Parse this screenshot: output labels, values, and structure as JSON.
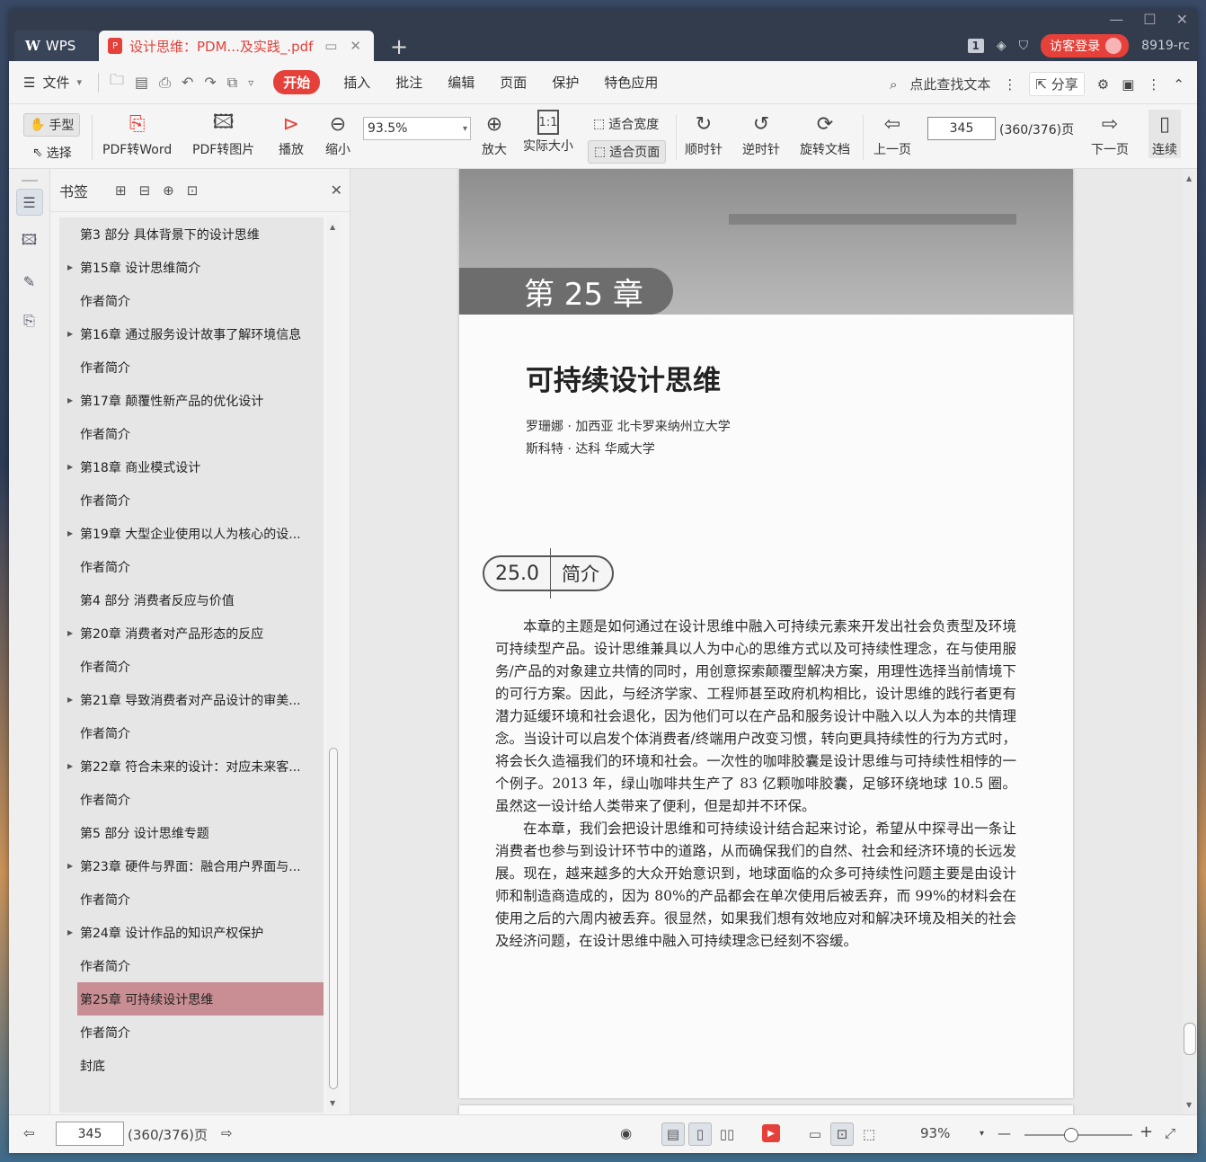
{
  "titlebar": {
    "app_tab": "WPS",
    "doc_tab": "设计思维：PDM...及实践_.pdf",
    "badge": "1",
    "guest_login": "访客登录",
    "version": "8919-rc"
  },
  "menu": {
    "file": "文件",
    "tabs": [
      "开始",
      "插入",
      "批注",
      "编辑",
      "页面",
      "保护",
      "特色应用"
    ],
    "active": "开始",
    "search": "点此查找文本",
    "share": "分享"
  },
  "toolbar": {
    "hand": "手型",
    "select": "选择",
    "pdf_to_word": "PDF转Word",
    "pdf_to_image": "PDF转图片",
    "play": "播放",
    "zoom_out": "缩小",
    "zoom_value": "93.5%",
    "zoom_in": "放大",
    "actual_size": "实际大小",
    "fit_width": "适合宽度",
    "fit_page": "适合页面",
    "clockwise": "顺时针",
    "counterclockwise": "逆时针",
    "rotate_doc": "旋转文档",
    "prev_page": "上一页",
    "page_value": "345",
    "page_total": "(360/376)页",
    "next_page": "下一页",
    "continuous": "连续"
  },
  "bookmarks": {
    "title": "书签",
    "items": [
      {
        "label": "第3 部分 具体背景下的设计思维",
        "expand": false
      },
      {
        "label": "第15章 设计思维简介",
        "expand": true
      },
      {
        "label": "作者简介",
        "expand": false
      },
      {
        "label": "第16章 通过服务设计故事了解环境信息",
        "expand": true
      },
      {
        "label": "作者简介",
        "expand": false
      },
      {
        "label": "第17章 颠覆性新产品的优化设计",
        "expand": true
      },
      {
        "label": "作者简介",
        "expand": false
      },
      {
        "label": "第18章 商业模式设计",
        "expand": true
      },
      {
        "label": "作者简介",
        "expand": false
      },
      {
        "label": "第19章 大型企业使用以人为核心的设...",
        "expand": true
      },
      {
        "label": "作者简介",
        "expand": false
      },
      {
        "label": "第4 部分 消费者反应与价值",
        "expand": false
      },
      {
        "label": "第20章 消费者对产品形态的反应",
        "expand": true
      },
      {
        "label": "作者简介",
        "expand": false
      },
      {
        "label": "第21章 导致消费者对产品设计的审美...",
        "expand": true
      },
      {
        "label": "作者简介",
        "expand": false
      },
      {
        "label": "第22章 符合未来的设计：对应未来客...",
        "expand": true
      },
      {
        "label": "作者简介",
        "expand": false
      },
      {
        "label": "第5 部分 设计思维专题",
        "expand": false
      },
      {
        "label": "第23章 硬件与界面：融合用户界面与...",
        "expand": true
      },
      {
        "label": "作者简介",
        "expand": false
      },
      {
        "label": "第24章 设计作品的知识产权保护",
        "expand": true
      },
      {
        "label": "作者简介",
        "expand": false
      },
      {
        "label": "第25章 可持续设计思维",
        "expand": true,
        "selected": true
      },
      {
        "label": "作者简介",
        "expand": false
      },
      {
        "label": "封底",
        "expand": false
      }
    ]
  },
  "page": {
    "chapter": "第 25 章",
    "title": "可持续设计思维",
    "author1": "罗珊娜 · 加西亚    北卡罗来纳州立大学",
    "author2": "斯科特 · 达科    华威大学",
    "section_num": "25.0",
    "section_name": "简介",
    "para1": "本章的主题是如何通过在设计思维中融入可持续元素来开发出社会负责型及环境可持续型产品。设计思维兼具以人为中心的思维方式以及可持续性理念，在与使用服务/产品的对象建立共情的同时，用创意探索颠覆型解决方案，用理性选择当前情境下的可行方案。因此，与经济学家、工程师甚至政府机构相比，设计思维的践行者更有潜力延缓环境和社会退化，因为他们可以在产品和服务设计中融入以人为本的共情理念。当设计可以启发个体消费者/终端用户改变习惯，转向更具持续性的行为方式时，将会长久造福我们的环境和社会。一次性的咖啡胶囊是设计思维与可持续性相悖的一个例子。2013 年，绿山咖啡共生产了 83 亿颗咖啡胶囊，足够环绕地球 10.5 圈。虽然这一设计给人类带来了便利，但是却并不环保。",
    "para2": "在本章，我们会把设计思维和可持续设计结合起来讨论，希望从中探寻出一条让消费者也参与到设计环节中的道路，从而确保我们的自然、社会和经济环境的长远发展。现在，越来越多的大众开始意识到，地球面临的众多可持续性问题主要是由设计师和制造商造成的，因为 80%的产品都会在单次使用后被丢弃，而 99%的材料会在使用之后的六周内被丢弃。很显然，如果我们想有效地应对和解决环境及相关的社会及经济问题，在设计思维中融入可持续理念已经刻不容缓。"
  },
  "status": {
    "page_value": "345",
    "page_total": "(360/376)页",
    "zoom": "93%"
  }
}
